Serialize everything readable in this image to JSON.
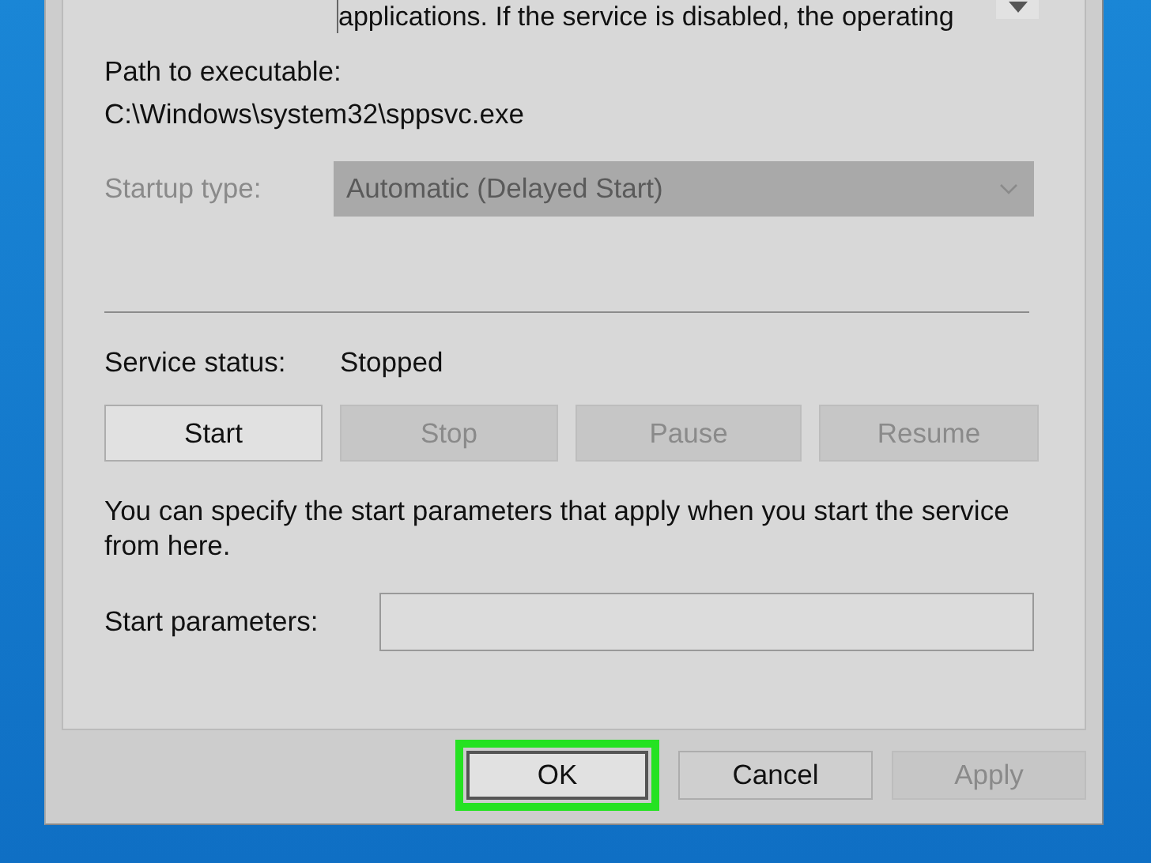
{
  "description": {
    "text": "applications. If the service is disabled, the operating"
  },
  "path": {
    "label": "Path to executable:",
    "value": "C:\\Windows\\system32\\sppsvc.exe"
  },
  "startup_type": {
    "label": "Startup type:",
    "value": "Automatic (Delayed Start)",
    "disabled": true
  },
  "service_status": {
    "label": "Service status:",
    "value": "Stopped"
  },
  "control_buttons": [
    {
      "label": "Start",
      "disabled": false
    },
    {
      "label": "Stop",
      "disabled": true
    },
    {
      "label": "Pause",
      "disabled": true
    },
    {
      "label": "Resume",
      "disabled": true
    }
  ],
  "hint": "You can specify the start parameters that apply when you start the service from here.",
  "start_parameters": {
    "label": "Start parameters:"
  },
  "dialog_buttons": [
    {
      "label": "OK",
      "highlighted": true,
      "disabled": false
    },
    {
      "label": "Cancel",
      "highlighted": false,
      "disabled": false
    },
    {
      "label": "Apply",
      "highlighted": false,
      "disabled": true
    }
  ]
}
